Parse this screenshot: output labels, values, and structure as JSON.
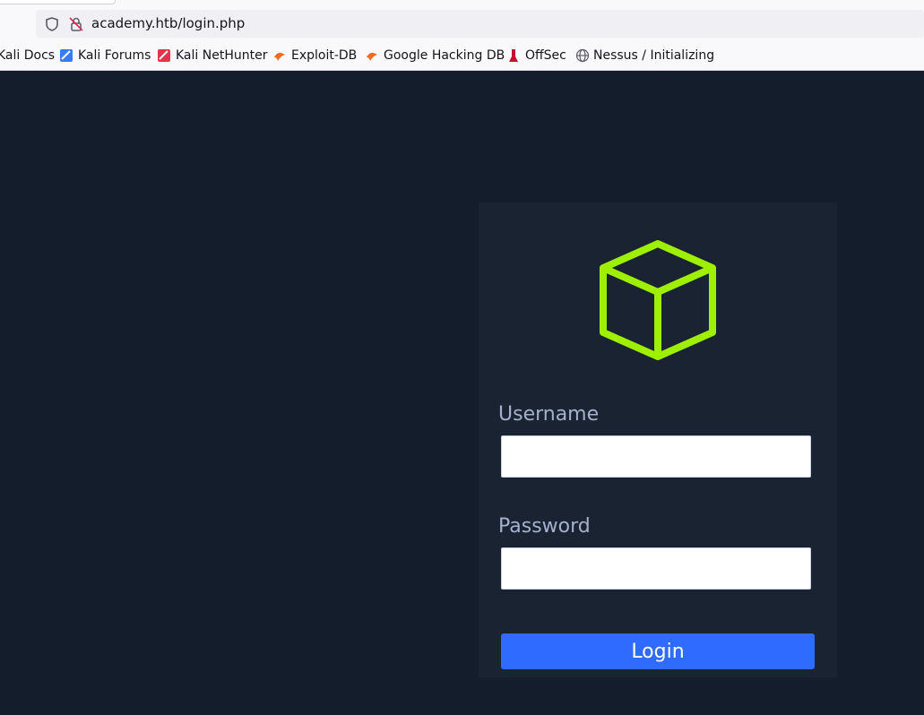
{
  "browser": {
    "url": "academy.htb/login.php",
    "bookmarks": [
      {
        "label": "Kali Docs",
        "icon": "kali-docs-icon"
      },
      {
        "label": "Kali Forums",
        "icon": "kali-forums-icon"
      },
      {
        "label": "Kali NetHunter",
        "icon": "kali-nethunter-icon"
      },
      {
        "label": "Exploit-DB",
        "icon": "exploit-db-icon"
      },
      {
        "label": "Google Hacking DB",
        "icon": "ghdb-icon"
      },
      {
        "label": "OffSec",
        "icon": "offsec-icon"
      },
      {
        "label": "Nessus / Initializing",
        "icon": "globe-icon"
      }
    ]
  },
  "login": {
    "username_label": "Username",
    "username_value": "",
    "password_label": "Password",
    "password_value": "",
    "button_label": "Login"
  },
  "colors": {
    "page_background": "#141d2b",
    "panel_background": "#1a2332",
    "logo_accent": "#9fef00",
    "button": "#2f6bff"
  }
}
